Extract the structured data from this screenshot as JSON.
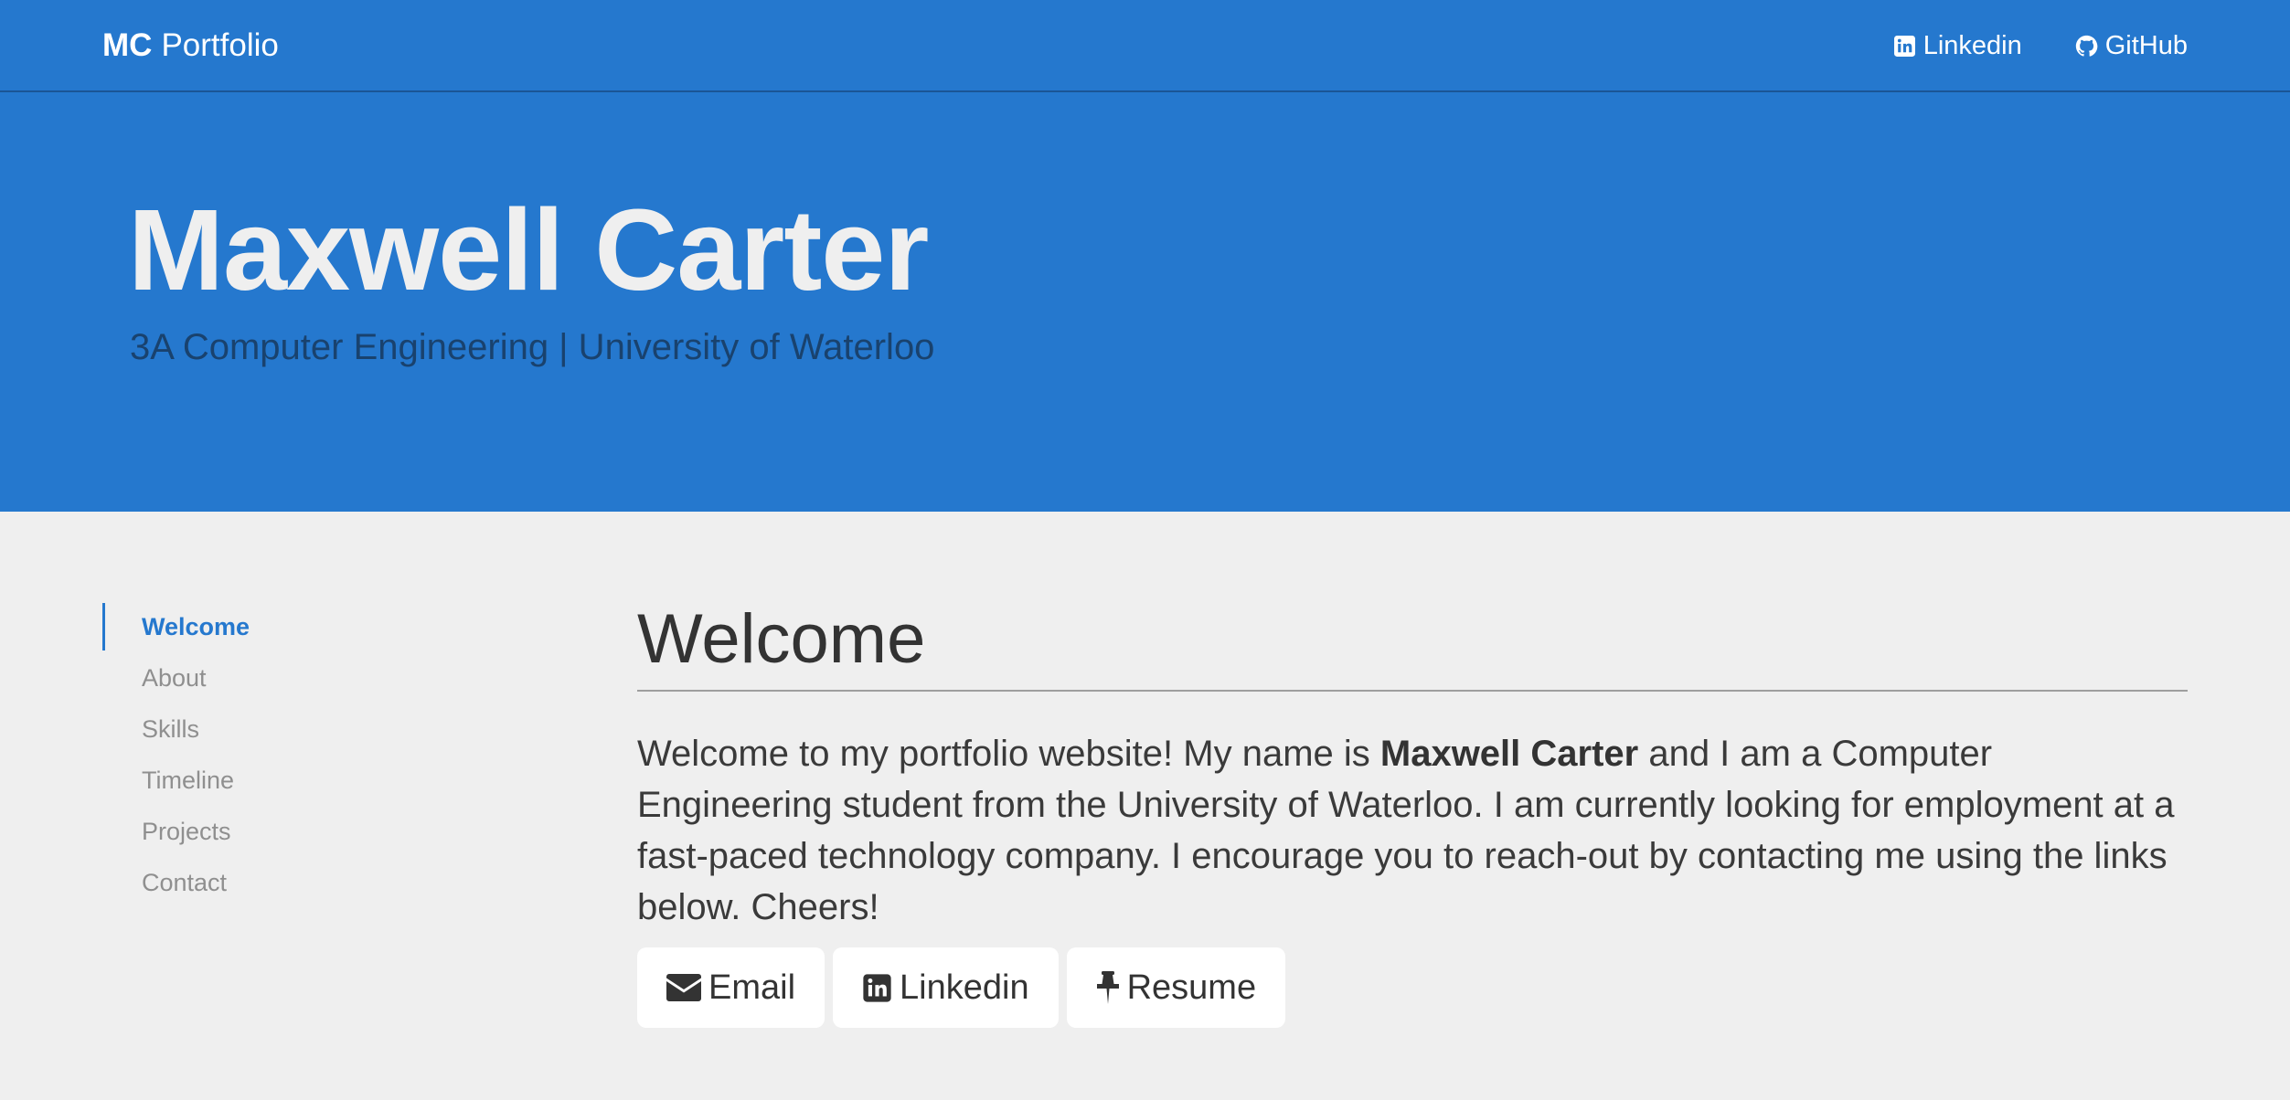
{
  "navbar": {
    "brand_initials": "MC",
    "brand_title": "Portfolio",
    "links": [
      {
        "label": "Linkedin",
        "icon": "linkedin-icon"
      },
      {
        "label": "GitHub",
        "icon": "github-icon"
      }
    ]
  },
  "hero": {
    "name": "Maxwell Carter",
    "subtitle": "3A Computer Engineering | University of Waterloo"
  },
  "sidebar": {
    "items": [
      {
        "label": "Welcome",
        "active": true
      },
      {
        "label": "About",
        "active": false
      },
      {
        "label": "Skills",
        "active": false
      },
      {
        "label": "Timeline",
        "active": false
      },
      {
        "label": "Projects",
        "active": false
      },
      {
        "label": "Contact",
        "active": false
      }
    ]
  },
  "main": {
    "title": "Welcome",
    "intro_before": "Welcome to my portfolio website! My name is ",
    "intro_name": "Maxwell Carter",
    "intro_after": " and I am a Computer Engineering student from the University of Waterloo. I am currently looking for employment at a fast-paced technology company. I encourage you to reach-out by contacting me using the links below. Cheers!",
    "buttons": [
      {
        "label": "Email",
        "icon": "envelope-icon"
      },
      {
        "label": "Linkedin",
        "icon": "linkedin-icon"
      },
      {
        "label": "Resume",
        "icon": "pushpin-icon"
      }
    ]
  },
  "colors": {
    "primary": "#2578ce",
    "page_background": "#efefef",
    "hero_subtitle": "#19426e",
    "sidebar_inactive": "#8f8f8f",
    "text": "#333333"
  }
}
